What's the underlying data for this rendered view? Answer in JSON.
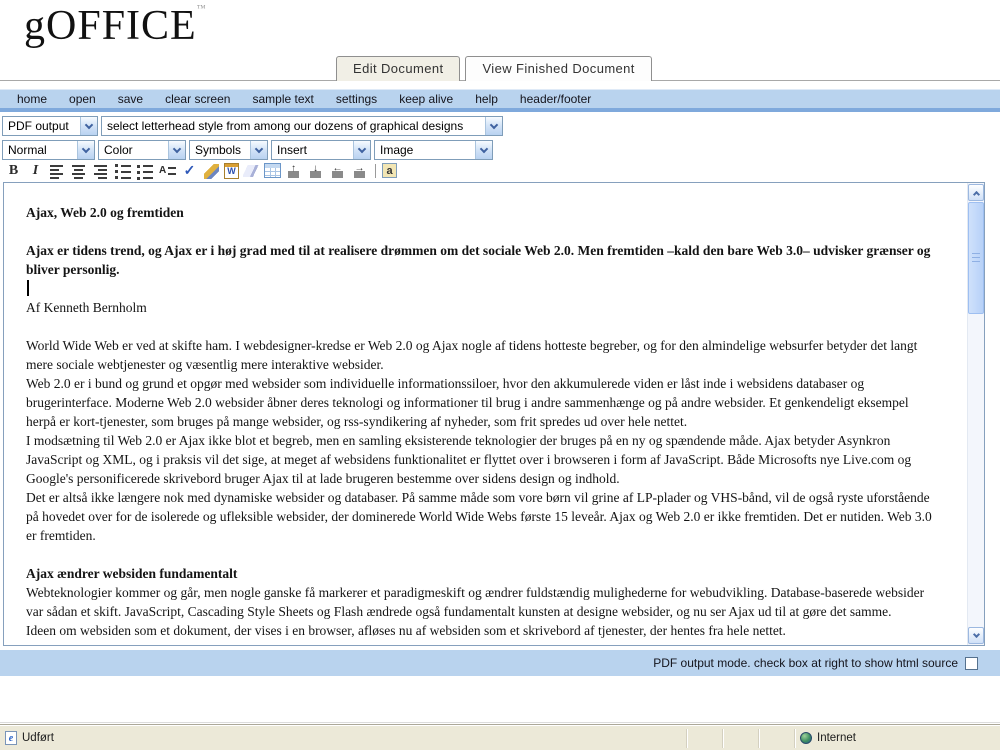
{
  "header": {
    "logo": "gOFFICE",
    "trademark": "™"
  },
  "tabs": [
    {
      "label": "Edit Document",
      "active": true
    },
    {
      "label": "View Finished Document",
      "active": false
    }
  ],
  "menu": {
    "items": [
      {
        "label": "home"
      },
      {
        "label": "open"
      },
      {
        "label": "save"
      },
      {
        "label": "clear screen"
      },
      {
        "label": "sample text"
      },
      {
        "label": "settings"
      },
      {
        "label": "keep alive"
      },
      {
        "label": "help"
      },
      {
        "label": "header/footer"
      }
    ]
  },
  "format_bar": {
    "output_select": "PDF output",
    "letterhead_select": "select letterhead style from among our dozens of graphical designs",
    "style_select": "Normal",
    "color_select": "Color",
    "symbols_select": "Symbols",
    "insert_select": "Insert",
    "image_select": "Image"
  },
  "toolbar": {
    "icons": [
      {
        "name": "bold",
        "glyph": "B"
      },
      {
        "name": "italic",
        "glyph": "I"
      },
      {
        "name": "align-left",
        "glyph": ""
      },
      {
        "name": "align-center",
        "glyph": ""
      },
      {
        "name": "align-right",
        "glyph": ""
      },
      {
        "name": "numbered-list",
        "glyph": ""
      },
      {
        "name": "bullet-list",
        "glyph": ""
      },
      {
        "name": "line-style",
        "glyph": "A"
      },
      {
        "name": "spellcheck",
        "glyph": "✓"
      },
      {
        "name": "format-painter",
        "glyph": ""
      },
      {
        "name": "paste-from-word",
        "glyph": "W"
      },
      {
        "name": "eraser",
        "glyph": ""
      },
      {
        "name": "insert-table",
        "glyph": ""
      },
      {
        "name": "insert-row",
        "glyph": "↑"
      },
      {
        "name": "split-cell",
        "glyph": "↓"
      },
      {
        "name": "insert-column",
        "glyph": "←"
      },
      {
        "name": "delete-column",
        "glyph": "→"
      },
      {
        "name": "html-mode",
        "glyph": "a"
      }
    ]
  },
  "document": {
    "paragraphs": [
      {
        "style": "heading",
        "text": "Ajax, Web 2.0 og fremtiden"
      },
      {
        "style": "lead-bold",
        "text": "Ajax er tidens trend, og Ajax er i høj grad med til at realisere drømmen om det sociale Web 2.0. Men fremtiden –kald den bare Web 3.0– udvisker grænser og bliver personlig."
      },
      {
        "style": "byline",
        "text": "Af Kenneth Bernholm"
      },
      {
        "style": "body",
        "text": "World Wide Web er ved at skifte ham. I webdesigner-kredse er Web 2.0 og Ajax nogle af tidens hotteste begreber, og for den almindelige websurfer betyder det langt mere sociale webtjenester og væsentlig mere interaktive websider."
      },
      {
        "style": "body",
        "text": "Web 2.0 er i bund og grund et opgør med websider som individuelle informationssiloer, hvor den akkumulerede viden er låst inde i websidens databaser og brugerinterface. Moderne Web 2.0 websider åbner deres teknologi og informationer til brug i andre sammenhænge og på andre websider. Et genkendeligt eksempel herpå er kort-tjenester, som bruges på mange websider, og rss-syndikering af nyheder, som frit spredes ud over hele nettet."
      },
      {
        "style": "body",
        "text": "I modsætning til Web 2.0 er Ajax ikke blot et begreb, men en samling eksisterende teknologier der bruges på en ny og spændende måde. Ajax betyder Asynkron JavaScript og XML, og i praksis vil det sige, at meget af websidens funktionalitet er flyttet over i browseren i form af JavaScript. Både Microsofts nye Live.com og Google's personificerede skrivebord bruger Ajax til at lade brugeren bestemme over sidens design og indhold."
      },
      {
        "style": "body",
        "text": "Det er altså ikke længere nok med dynamiske websider og databaser. På samme måde som vore børn vil grine af LP-plader og VHS-bånd, vil de også ryste uforstående på hovedet over for de isolerede og ufleksible websider, der dominerede World Wide Webs første 15 leveår. Ajax og Web 2.0 er ikke fremtiden. Det er nutiden. Web 3.0 er fremtiden."
      },
      {
        "style": "heading2",
        "text": "Ajax ændrer websiden fundamentalt"
      },
      {
        "style": "body",
        "text": "Webteknologier kommer og går, men nogle ganske få markerer et paradigmeskift og ændrer fuldstændig mulighederne for webudvikling. Database-baserede websider var sådan et skift. JavaScript, Cascading Style Sheets og Flash ændrede også fundamentalt kunsten at designe websider, og nu ser Ajax ud til at gøre det samme."
      },
      {
        "style": "body-clipped",
        "visible": "partial",
        "text": "Ideen om websiden som et dokument, der vises i en browser, afløses nu af websiden som et skrivebord af tjenester, der hentes fra hele nettet."
      }
    ]
  },
  "footer": {
    "mode_note": "PDF output mode. check box at right to show html source"
  },
  "statusbar": {
    "status": "Udført",
    "doc_icon_glyph": "e",
    "zone": "Internet"
  },
  "colors": {
    "menubar_blue": "#b9d3ee",
    "menubar_edge_blue": "#7fa9dc",
    "statusbar_beige": "#ece9d8",
    "editor_border": "#86a0bd"
  }
}
